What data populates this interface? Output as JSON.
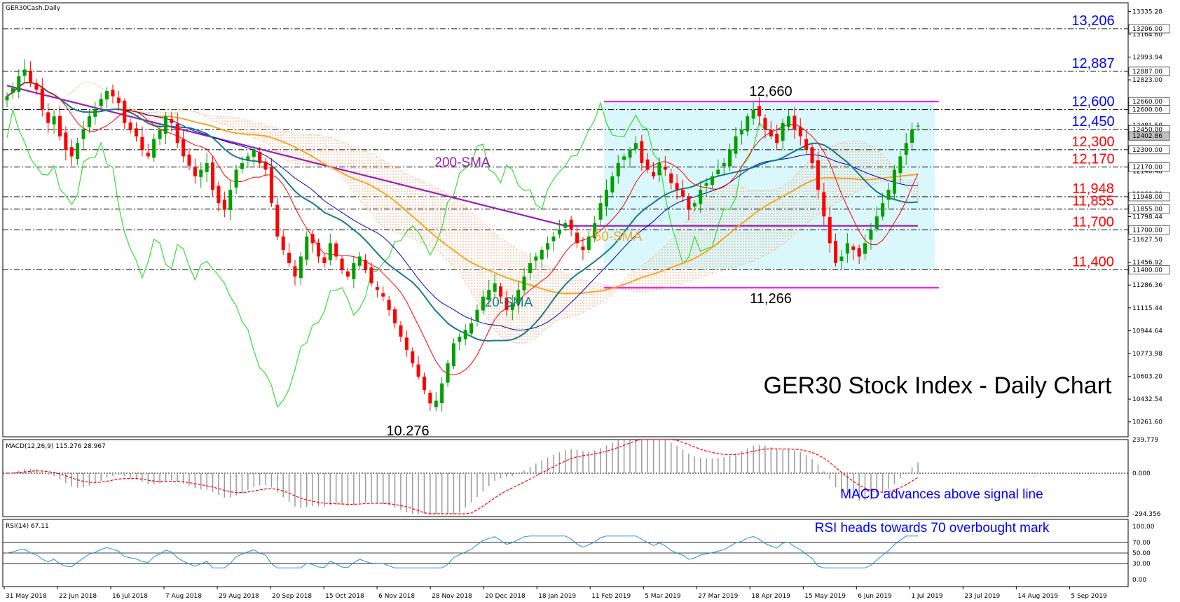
{
  "symbol_label": "GER30Cash,Daily",
  "chart_data": {
    "type": "candlestick",
    "title": "GER30 Stock Index - Daily Chart",
    "ylim": [
      10150,
      13400
    ],
    "price_axis_ticks": [
      "13335.28",
      "13164.60",
      "12993.94",
      "12823.00",
      "12652.40",
      "12481.50",
      "12311.00",
      "12140.48",
      "11969.80",
      "11798.44",
      "11627.50",
      "11456.92",
      "11286.36",
      "11115.44",
      "10944.64",
      "10773.98",
      "10603.20",
      "10432.54",
      "10261.60"
    ],
    "price_axis_tags": [
      "13206.00",
      "12887.00",
      "12660.00",
      "12600.00",
      "12450.00",
      "12402.86",
      "12300.00",
      "12170.00",
      "11948.00",
      "11855.00",
      "11700.00",
      "11400.00"
    ],
    "x_labels": [
      "31 May 2018",
      "22 Jun 2018",
      "16 Jul 2018",
      "7 Aug 2018",
      "29 Aug 2018",
      "20 Sep 2018",
      "15 Oct 2018",
      "6 Nov 2018",
      "28 Nov 2018",
      "20 Dec 2018",
      "18 Jan 2019",
      "11 Feb 2019",
      "5 Mar 2019",
      "27 Mar 2019",
      "18 Apr 2019",
      "15 May 2019",
      "6 Jun 2019",
      "1 Jul 2019",
      "23 Jul 2019",
      "14 Aug 2019",
      "5 Sep 2019"
    ],
    "levels": [
      {
        "value": 13206,
        "label": "13,206",
        "color": "#0000ff"
      },
      {
        "value": 12887,
        "label": "12,887",
        "color": "#0000ff"
      },
      {
        "value": 12600,
        "label": "12,600",
        "color": "#0000ff"
      },
      {
        "value": 12450,
        "label": "12,450",
        "color": "#0000ff"
      },
      {
        "value": 12300,
        "label": "12,300",
        "color": "#ff0000"
      },
      {
        "value": 12170,
        "label": "12,170",
        "color": "#ff0000"
      },
      {
        "value": 11948,
        "label": "11,948",
        "color": "#ff0000"
      },
      {
        "value": 11855,
        "label": "11,855",
        "color": "#ff0000"
      },
      {
        "value": 11700,
        "label": "11,700",
        "color": "#ff0000"
      },
      {
        "value": 11400,
        "label": "11,400",
        "color": "#ff0000"
      }
    ],
    "range": {
      "top": 12660,
      "bottom": 11266,
      "top_label": "12,660",
      "bottom_label": "11,266"
    },
    "low_label": "10.276",
    "low_value": 10276,
    "sma_labels": {
      "sma200": "200-SMA",
      "sma50": "50-SMA",
      "sma20": "20-SMA"
    },
    "closes": [
      12700,
      12760,
      12850,
      12900,
      12800,
      12750,
      12600,
      12500,
      12550,
      12400,
      12300,
      12250,
      12350,
      12450,
      12550,
      12600,
      12680,
      12740,
      12700,
      12650,
      12500,
      12450,
      12400,
      12300,
      12250,
      12380,
      12450,
      12550,
      12500,
      12350,
      12250,
      12180,
      12100,
      12150,
      12200,
      12000,
      11900,
      11850,
      12000,
      12150,
      12200,
      12250,
      12300,
      12200,
      12150,
      11900,
      11650,
      11550,
      11450,
      11350,
      11500,
      11650,
      11600,
      11500,
      11450,
      11600,
      11500,
      11400,
      11350,
      11450,
      11500,
      11400,
      11300,
      11250,
      11200,
      11100,
      11000,
      10900,
      10800,
      10700,
      10600,
      10500,
      10400,
      10420,
      10550,
      10700,
      10850,
      10900,
      10950,
      11000,
      11100,
      11200,
      11250,
      11300,
      11200,
      11100,
      11150,
      11250,
      11350,
      11450,
      11500,
      11550,
      11600,
      11650,
      11700,
      11750,
      11700,
      11600,
      11550,
      11650,
      11750,
      11900,
      12000,
      12100,
      12200,
      12250,
      12300,
      12350,
      12200,
      12150,
      12100,
      12200,
      12150,
      12050,
      12000,
      11950,
      11850,
      11900,
      12000,
      12050,
      12100,
      12150,
      12200,
      12300,
      12400,
      12450,
      12550,
      12600,
      12550,
      12450,
      12400,
      12350,
      12500,
      12550,
      12450,
      12400,
      12300,
      12200,
      12000,
      11800,
      11600,
      11450,
      11500,
      11600,
      11550,
      11500,
      11600,
      11700,
      11800,
      11900,
      12000,
      12150,
      12250,
      12350,
      12450,
      12480
    ],
    "macd": {
      "label": "MACD(12,26,9) 115.276 28.967",
      "ticks": [
        "239.779",
        "0.000",
        "-294.356"
      ],
      "annotation": "MACD advances above signal line"
    },
    "rsi": {
      "label": "RSI(14) 67.11",
      "ticks": [
        "100.00",
        "70.00",
        "50.00",
        "30.00",
        "0.00"
      ],
      "annotation": "RSI heads towards 70 overbought mark"
    }
  },
  "colors": {
    "bull": "#00a000",
    "bear": "#ff0000",
    "sma200": "#9a1fb7",
    "sma50": "#f5a623",
    "sma20": "#167a8a",
    "tenkan": "#ff0000",
    "kijun": "#0000cc",
    "chikou": "#33dd33",
    "cloud": "#f0a070",
    "range_fill": "#d6f6fb",
    "range_line": "#ff00ff",
    "macd_hist": "#9a9a9a",
    "macd_signal": "#ff0000",
    "rsi_line": "#1e8fd6"
  }
}
